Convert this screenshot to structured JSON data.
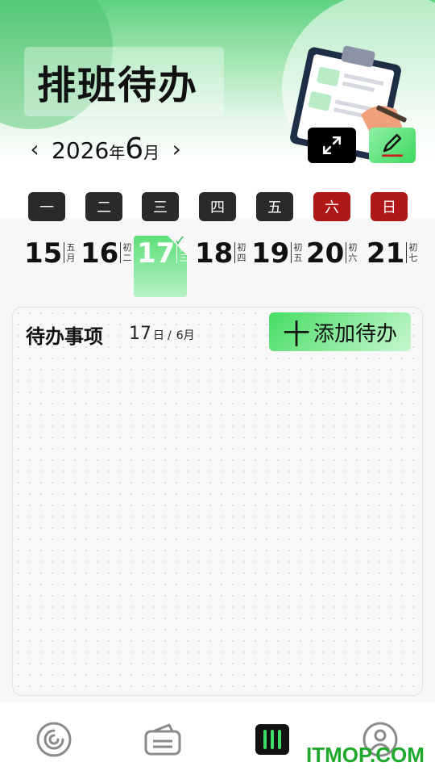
{
  "header": {
    "title": "排班待办",
    "year": "2026",
    "year_unit": "年",
    "month": "6",
    "month_unit": "月",
    "prev_icon": "chevron-left-icon",
    "next_icon": "chevron-right-icon",
    "expand_icon": "expand-icon",
    "edit_icon": "pencil-icon"
  },
  "weekdays": [
    "一",
    "二",
    "三",
    "四",
    "五",
    "六",
    "日"
  ],
  "dates": [
    {
      "day": "15",
      "lunar": "五月",
      "selected": false
    },
    {
      "day": "16",
      "lunar": "初二",
      "selected": false
    },
    {
      "day": "17",
      "lunar": "初三",
      "selected": true
    },
    {
      "day": "18",
      "lunar": "初四",
      "selected": false
    },
    {
      "day": "19",
      "lunar": "初五",
      "selected": false
    },
    {
      "day": "20",
      "lunar": "初六",
      "selected": false
    },
    {
      "day": "21",
      "lunar": "初七",
      "selected": false
    }
  ],
  "todo": {
    "title": "待办事项",
    "day": "17",
    "day_unit": "日",
    "separator": "/",
    "month_label": "6月",
    "add_plus": "十",
    "add_label": "添加待办"
  },
  "nav": [
    {
      "icon": "spiral-icon",
      "active": false
    },
    {
      "icon": "ticket-icon",
      "active": false
    },
    {
      "icon": "schedule-icon",
      "active": true
    },
    {
      "icon": "profile-icon",
      "active": false
    }
  ],
  "watermark": "ITMOP.COM",
  "colors": {
    "accent": "#4cdc6a",
    "weekend": "#b01818",
    "dark": "#2a2a2a"
  }
}
